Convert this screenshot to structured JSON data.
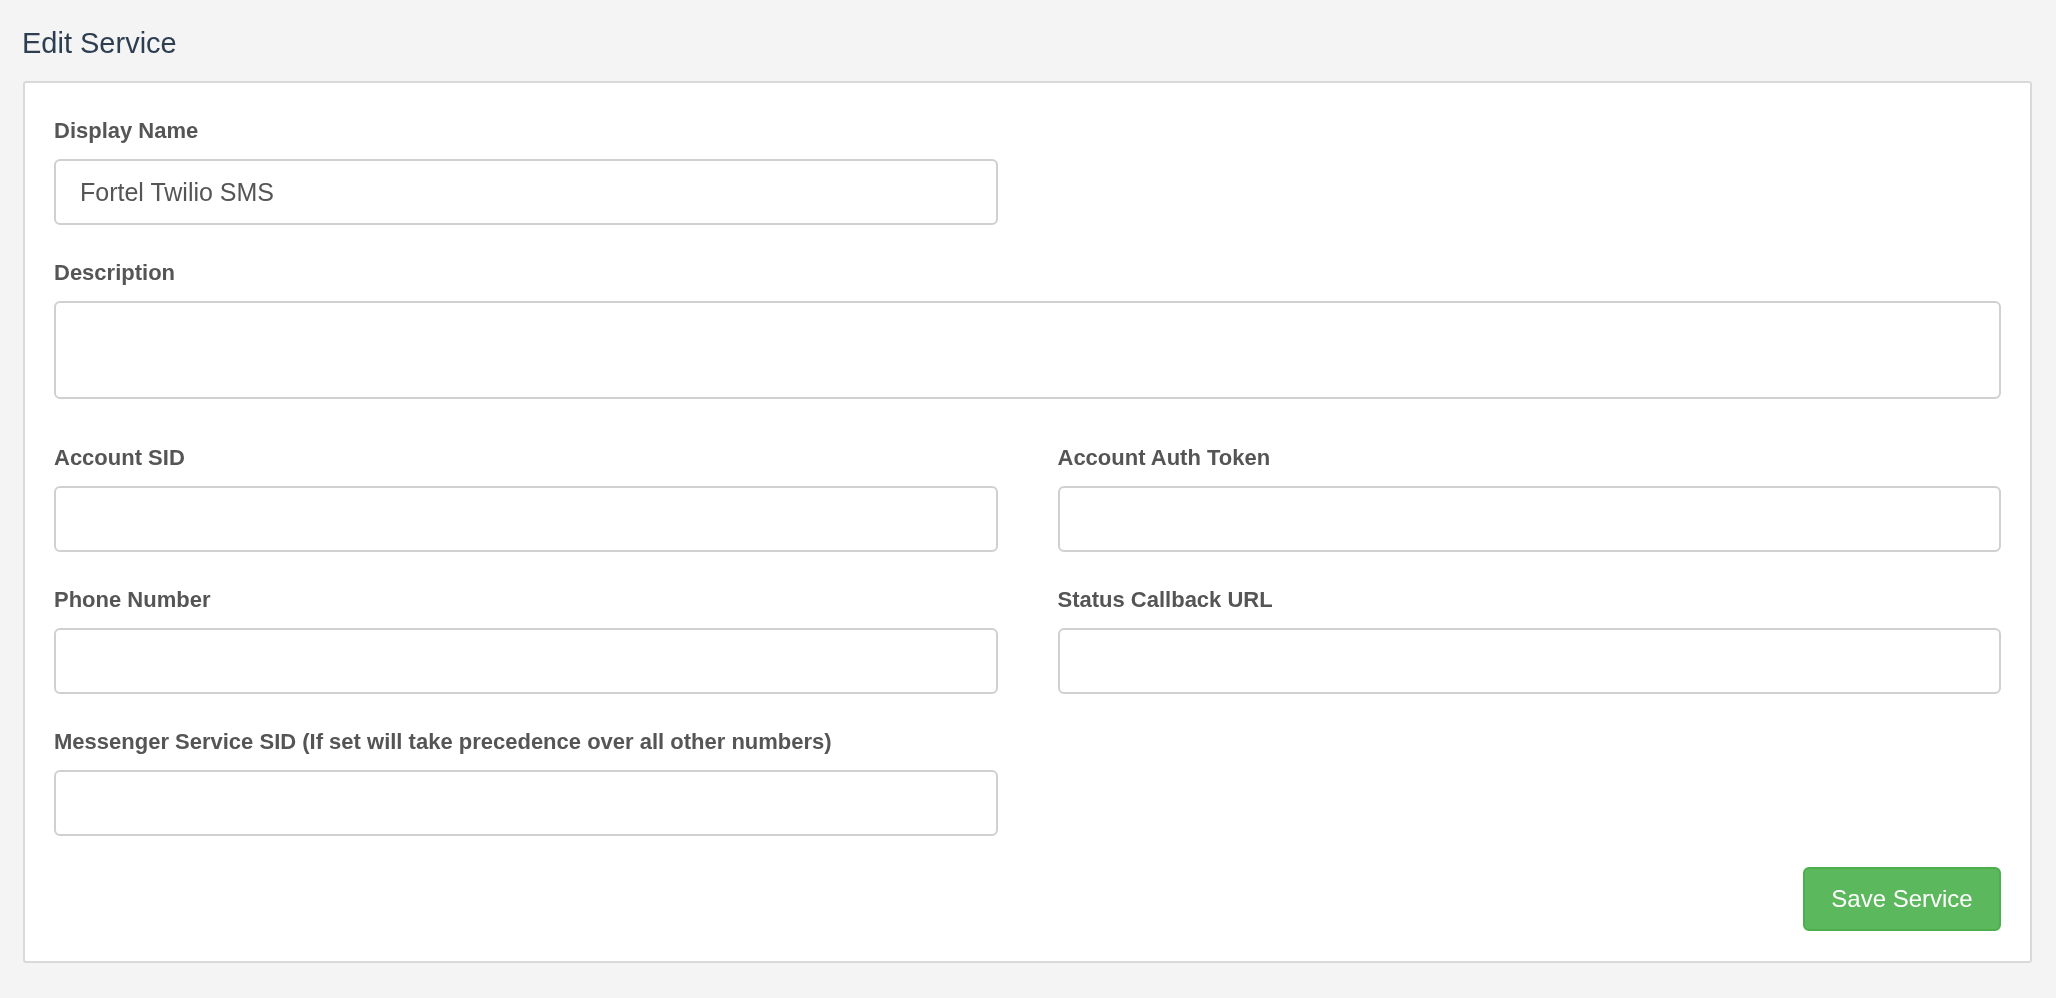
{
  "title": "Edit Service",
  "rows": [
    {
      "fields": [
        {
          "kind": "text",
          "label": "Display Name",
          "value": "Fortel Twilio SMS"
        }
      ]
    },
    {
      "fields": [
        {
          "kind": "textarea",
          "label": "Description"
        }
      ]
    },
    {
      "fields": [
        {
          "kind": "text",
          "label": "Account SID"
        },
        {
          "kind": "text",
          "label": "Account Auth Token"
        }
      ]
    },
    {
      "fields": [
        {
          "kind": "text",
          "label": "Phone Number"
        },
        {
          "kind": "text",
          "label": "Status Callback URL"
        }
      ]
    },
    {
      "fields": [
        {
          "kind": "text",
          "label": "Messenger Service SID (If set will take precedence over all other numbers)"
        }
      ]
    }
  ],
  "save_button": "Save Service"
}
